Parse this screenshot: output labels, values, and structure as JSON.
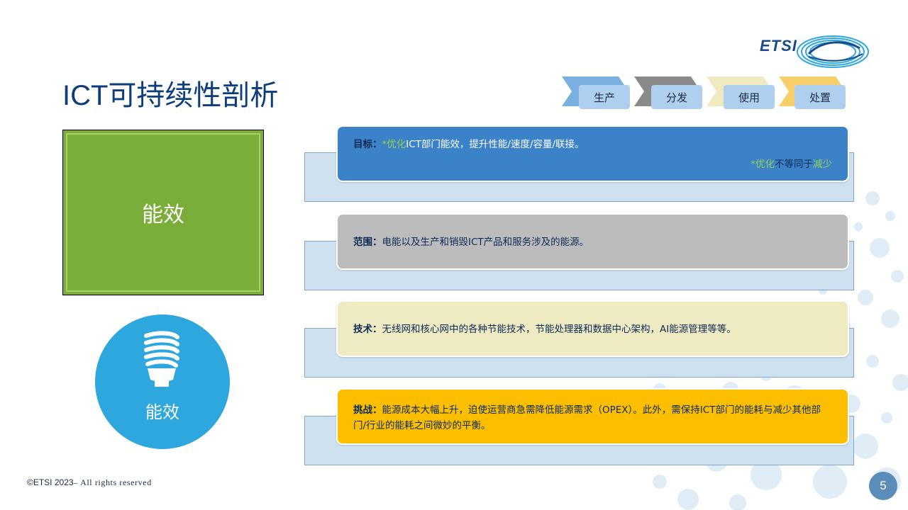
{
  "slide": {
    "title": "ICT可持续性剖析",
    "logo_text": "ETSI",
    "process_steps": [
      {
        "label": "生产",
        "chevron_color": "#7ab0df",
        "box_color": "#aed0ee"
      },
      {
        "label": "分发",
        "chevron_color": "#8a8a8a",
        "box_color": "#aed0ee"
      },
      {
        "label": "使用",
        "chevron_color": "#efeac0",
        "box_color": "#aed0ee"
      },
      {
        "label": "处置",
        "chevron_color": "#f6cf6a",
        "box_color": "#aed0ee"
      }
    ],
    "green_box_label": "能效",
    "circle_label": "能效",
    "rows": [
      {
        "key": "目标：",
        "text_green": "*优化",
        "text": "ICT部门能效，提升性能/速度/容量/联接。",
        "note_green1": "*优化",
        "note_dark": "不等同于",
        "note_green2": "减少"
      },
      {
        "key": "范围：",
        "text": "电能以及生产和销毁ICT产品和服务涉及的能源。"
      },
      {
        "key": "技术：",
        "text": "无线网和核心网中的各种节能技术，节能处理器和数据中心架构，AI能源管理等等。"
      },
      {
        "key": "挑战：",
        "text": "能源成本大幅上升，迫使运营商急需降低能源需求（OPEX）。此外，需保持ICT部门的能耗与减少其他部门/行业的能耗之间微妙的平衡。"
      }
    ],
    "footer": {
      "copyright": "©ETSI 2023",
      "rights": "– All rights reserved"
    },
    "page_number": "5",
    "colors": {
      "title": "#0d3d7a",
      "green_box": "#7aad3a",
      "circle": "#2ea7de",
      "card_blue": "#3c82c9",
      "card_grey": "#bcbcbc",
      "card_yellow": "#eeebc3",
      "card_gold": "#fcbf00",
      "accent_green": "#92d050"
    }
  }
}
